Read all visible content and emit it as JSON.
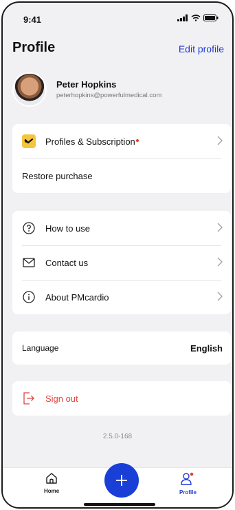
{
  "status": {
    "time": "9:41"
  },
  "header": {
    "title": "Profile",
    "edit_label": "Edit profile"
  },
  "user": {
    "name": "Peter Hopkins",
    "email": "peterhopkins@powerfulmedical.com"
  },
  "subscription": {
    "items": [
      {
        "label": "Profiles & Subscription",
        "icon": "subscription-icon",
        "has_badge": true
      },
      {
        "label": "Restore purchase"
      }
    ]
  },
  "help": {
    "items": [
      {
        "label": "How to use",
        "icon": "question-circle-icon"
      },
      {
        "label": "Contact us",
        "icon": "mail-icon"
      },
      {
        "label": "About PMcardio",
        "icon": "info-circle-icon"
      }
    ]
  },
  "language": {
    "label": "Language",
    "value": "English"
  },
  "signout": {
    "label": "Sign out",
    "icon": "sign-out-icon"
  },
  "version": "2.5.0-168",
  "tabbar": {
    "home_label": "Home",
    "profile_label": "Profile"
  },
  "colors": {
    "accent": "#1F3BD3",
    "danger": "#E1453B",
    "subscription_icon_bg": "#F6C53F",
    "background": "#F1F1F4"
  }
}
